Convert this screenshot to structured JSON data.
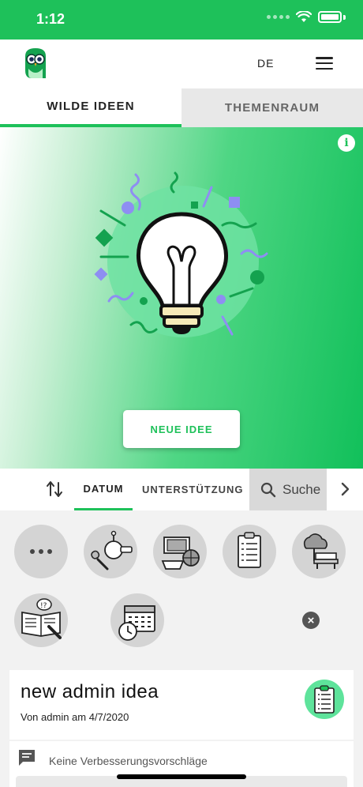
{
  "status": {
    "time": "1:12"
  },
  "header": {
    "lang": "DE"
  },
  "tabs": [
    {
      "label": "WILDE IDEEN",
      "active": true
    },
    {
      "label": "THEMENRAUM",
      "active": false
    }
  ],
  "hero": {
    "button_label": "NEUE IDEE"
  },
  "sort": {
    "date_label": "DATUM",
    "support_label": "UNTERSTÜTZUNG",
    "search_label": "Suche"
  },
  "categories": [
    {
      "icon": "more-icon"
    },
    {
      "icon": "music-microphone-icon"
    },
    {
      "icon": "sports-equipment-icon"
    },
    {
      "icon": "clipboard-icon"
    },
    {
      "icon": "park-bench-icon"
    },
    {
      "icon": "book-speech-icon"
    },
    {
      "icon": "calendar-clock-icon"
    }
  ],
  "idea": {
    "title": "new admin idea",
    "meta": "Von admin am 4/7/2020",
    "comments": "Keine Verbesserungsvorschläge"
  },
  "colors": {
    "accent": "#1ec15a",
    "circle": "#d4d4d4"
  }
}
